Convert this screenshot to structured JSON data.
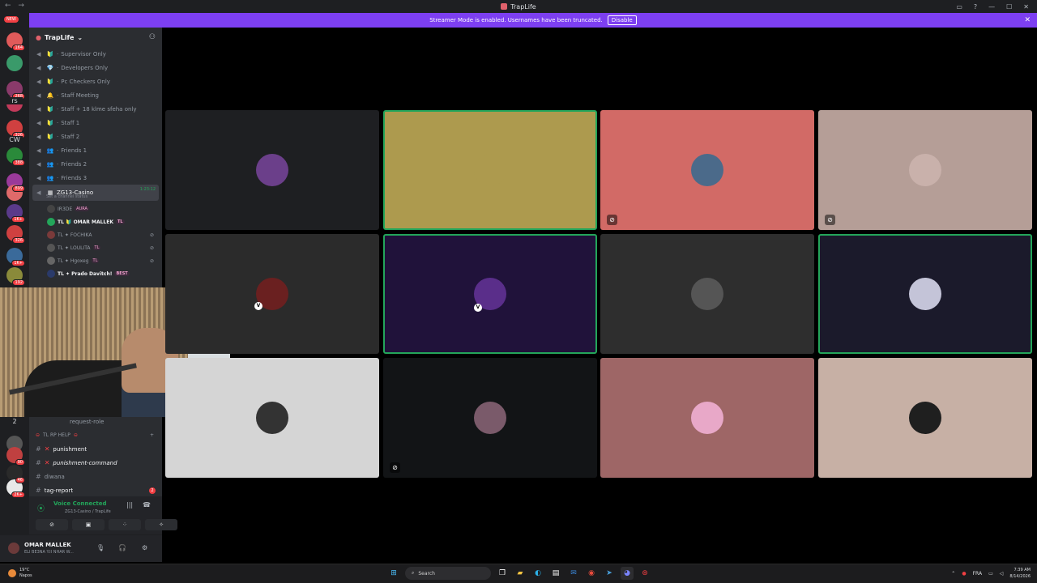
{
  "window": {
    "title": "TrapLife",
    "nav": "← →"
  },
  "banner": {
    "text": "Streamer Mode is enabled. Usernames have been truncated.",
    "button": "Disable"
  },
  "guilds": {
    "new_label": "NEW",
    "badges": [
      "164",
      "268",
      "326",
      "388",
      "899",
      "1K+",
      "326",
      "1K+",
      "192",
      "90",
      "46",
      "2K+"
    ],
    "text_items": [
      "rs",
      "CW",
      "2"
    ]
  },
  "server": {
    "name": "TrapLife"
  },
  "voice_channels": [
    {
      "emoji": "🔰",
      "name": "Supervisor Only"
    },
    {
      "emoji": "💎",
      "name": "Developers Only"
    },
    {
      "emoji": "🔰",
      "name": "Pc Checkers Only"
    },
    {
      "emoji": "🔔",
      "name": "Staff Meeting"
    },
    {
      "emoji": "🔰",
      "name": "Staff + 18 klme sfeha only"
    },
    {
      "emoji": "🔰",
      "name": "Staff 1"
    },
    {
      "emoji": "🔰",
      "name": "Staff 2"
    },
    {
      "emoji": "👥",
      "name": "Friends 1"
    },
    {
      "emoji": "👥",
      "name": "Friends 2"
    },
    {
      "emoji": "👥",
      "name": "Friends 3"
    }
  ],
  "active_channel": {
    "name": "ZG13-Casino",
    "time": "1:23:12",
    "status": "Set a channel status"
  },
  "members": [
    {
      "name": "IR3DE",
      "tag": "AURA"
    },
    {
      "name": "TL 🔰 OMAR MALLEK",
      "tag": "TL"
    },
    {
      "name": "TL ✦ FOCHIKA",
      "tag": ""
    },
    {
      "name": "TL ✦ LOULITA",
      "tag": "TL"
    },
    {
      "name": "TL ✦ Hgoxeg",
      "tag": "TL"
    },
    {
      "name": "TL ✦ Prado Davitch!",
      "tag": "BEST"
    }
  ],
  "text_channels": {
    "request": "request-role",
    "category": "TL RP HELP",
    "items": [
      {
        "name": "punishment",
        "bold": true
      },
      {
        "name": "punishment-command",
        "bold": true
      },
      {
        "name": "diwana",
        "bold": false
      },
      {
        "name": "tag-report",
        "bold": true,
        "count": "2"
      }
    ]
  },
  "voice_status": {
    "label": "Voice Connected",
    "sub": "ZG13-Casino / TrapLife"
  },
  "user": {
    "name": "OMAR MALLEK",
    "status": "ELI BE3NA Y.II NHAR W..."
  },
  "tiles": [
    {
      "bg": "#1e1f22",
      "avatar": "#6b3f8a",
      "speaking": false,
      "muted": false
    },
    {
      "bg": "#ad9a4e",
      "avatar": "#ad9a4e",
      "speaking": true,
      "muted": false
    },
    {
      "bg": "#d26a66",
      "avatar": "#4b6a8a",
      "speaking": false,
      "muted": true
    },
    {
      "bg": "#b59e97",
      "avatar": "#c9b1ab",
      "speaking": false,
      "muted": true
    },
    {
      "bg": "#2b2b2b",
      "avatar": "#6a2020",
      "speaking": false,
      "muted": false
    },
    {
      "bg": "#20123a",
      "avatar": "#5a2e8a",
      "speaking": true,
      "muted": false
    },
    {
      "bg": "#2e2e2e",
      "avatar": "#555555",
      "speaking": false,
      "muted": false
    },
    {
      "bg": "#1b1a2b",
      "avatar": "#c4c4d8",
      "speaking": true,
      "muted": false
    },
    {
      "bg": "#d5d5d5",
      "avatar": "#333333",
      "speaking": false,
      "muted": false
    },
    {
      "bg": "#121416",
      "avatar": "#7a5a6a",
      "speaking": false,
      "muted": true
    },
    {
      "bg": "#9e6666",
      "avatar": "#e8a8c8",
      "speaking": false,
      "muted": false
    },
    {
      "bg": "#c7b0a5",
      "avatar": "#1f1f1f",
      "speaking": false,
      "muted": false
    }
  ],
  "taskbar": {
    "weather_temp": "19°C",
    "weather_place": "Napos",
    "search_placeholder": "Search",
    "lang": "FRA",
    "time": "7:39 AM",
    "date": "8/14/2026"
  }
}
